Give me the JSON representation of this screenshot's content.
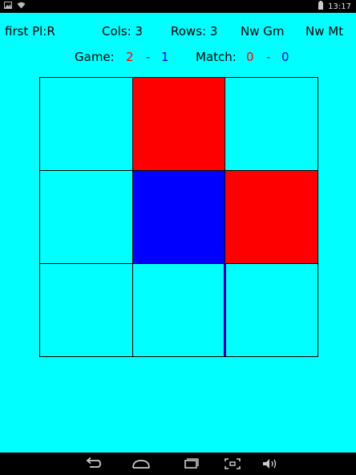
{
  "status_bar": {
    "time": "13:17",
    "icons": [
      "image-icon",
      "wifi-icon",
      "battery-icon"
    ]
  },
  "header": {
    "first_player": "first Pl:R",
    "cols": "Cols: 3",
    "rows": "Rows: 3",
    "new_game": "Nw Gm",
    "new_match": "Nw Mt"
  },
  "score": {
    "game_label": "Game:",
    "game_red": "2",
    "game_dash": "-",
    "game_blue": "1",
    "match_label": "Match:",
    "match_red": "0",
    "match_dash": "-",
    "match_blue": "0",
    "colors": {
      "red": "#ff0000",
      "blue": "#0000ff"
    }
  },
  "board": {
    "cols": 3,
    "rows": 3,
    "cells": [
      [
        "empty",
        "red",
        "empty"
      ],
      [
        "empty",
        "blue",
        "red"
      ],
      [
        "empty",
        "empty",
        "empty"
      ]
    ],
    "background": "#00ffff"
  },
  "nav_bar": {
    "icons": [
      "back-icon",
      "home-icon",
      "recent-apps-icon",
      "screenshot-icon",
      "volume-icon"
    ]
  }
}
